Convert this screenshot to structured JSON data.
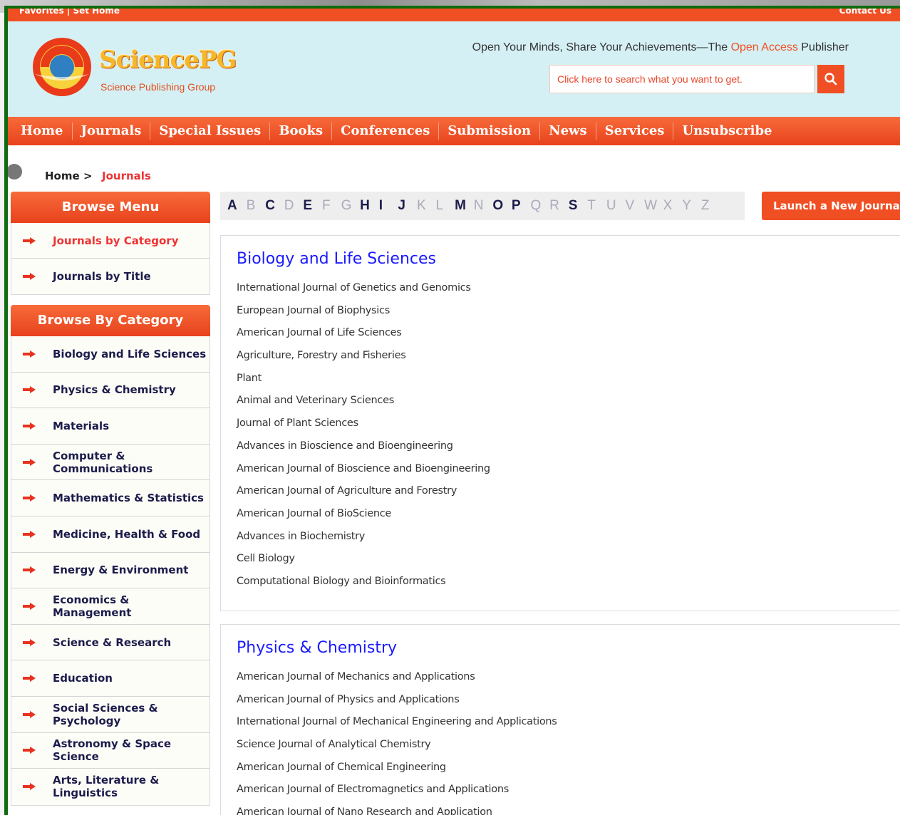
{
  "topbar": {
    "left": "Favorites  |  Set Home",
    "right": "Contact Us"
  },
  "header": {
    "logo_text": "SciencePG",
    "logo_sub": "Science Publishing Group",
    "slogan_pre": "Open Your Minds, Share Your Achievements—The ",
    "slogan_hl": "Open Access",
    "slogan_post": " Publisher",
    "search_placeholder": "Click here to search what you want to get."
  },
  "nav": [
    "Home",
    "Journals",
    "Special Issues",
    "Books",
    "Conferences",
    "Submission",
    "News",
    "Services",
    "Unsubscribe"
  ],
  "breadcrumb": {
    "home": "Home",
    "sep": ">",
    "current": "Journals"
  },
  "browse_menu": {
    "title": "Browse Menu",
    "items": [
      "Journals by Category",
      "Journals by Title"
    ]
  },
  "browse_category": {
    "title": "Browse By Category",
    "items": [
      "Biology and Life Sciences",
      "Physics & Chemistry",
      "Materials",
      "Computer & Communications",
      "Mathematics & Statistics",
      "Medicine, Health & Food",
      "Energy & Environment",
      "Economics & Management",
      "Science & Research",
      "Education",
      "Social Sciences & Psychology",
      "Astronomy & Space Science",
      "Arts, Literature & Linguistics"
    ]
  },
  "letters": [
    {
      "l": "A",
      "on": true
    },
    {
      "l": "B",
      "on": false
    },
    {
      "l": "C",
      "on": true
    },
    {
      "l": "D",
      "on": false
    },
    {
      "l": "E",
      "on": true
    },
    {
      "l": "F",
      "on": false
    },
    {
      "l": "G",
      "on": false
    },
    {
      "l": "H",
      "on": true
    },
    {
      "l": "I",
      "on": true
    },
    {
      "l": "J",
      "on": true
    },
    {
      "l": "K",
      "on": false
    },
    {
      "l": "L",
      "on": false
    },
    {
      "l": "M",
      "on": true
    },
    {
      "l": "N",
      "on": false
    },
    {
      "l": "O",
      "on": true
    },
    {
      "l": "P",
      "on": true
    },
    {
      "l": "Q",
      "on": false
    },
    {
      "l": "R",
      "on": false
    },
    {
      "l": "S",
      "on": true
    },
    {
      "l": "T",
      "on": false
    },
    {
      "l": "U",
      "on": false
    },
    {
      "l": "V",
      "on": false
    },
    {
      "l": "W",
      "on": false
    },
    {
      "l": "X",
      "on": false
    },
    {
      "l": "Y",
      "on": false
    },
    {
      "l": "Z",
      "on": false
    }
  ],
  "launch_label": "Launch a New Journal",
  "sections": [
    {
      "title": "Biology and Life Sciences",
      "journals": [
        "International Journal of Genetics and Genomics",
        "European Journal of Biophysics",
        "American Journal of Life Sciences",
        "Agriculture, Forestry and Fisheries",
        "Plant",
        "Animal and Veterinary Sciences",
        "Journal of Plant Sciences",
        "Advances in Bioscience and Bioengineering",
        "American Journal of Bioscience and Bioengineering",
        "American Journal of Agriculture and Forestry",
        "American Journal of BioScience",
        "Advances in Biochemistry",
        "Cell Biology",
        "Computational Biology and Bioinformatics"
      ]
    },
    {
      "title": "Physics & Chemistry",
      "journals": [
        "American Journal of Mechanics and Applications",
        "American Journal of Physics and Applications",
        "International Journal of Mechanical Engineering and Applications",
        "Science Journal of Analytical Chemistry",
        "American Journal of Chemical Engineering",
        "American Journal of Electromagnetics and Applications",
        "American Journal of Nano Research and Application"
      ]
    }
  ],
  "colors": {
    "accent": "#f04f23",
    "header_bg": "#d5f0f4",
    "link_blue": "#1a1aff",
    "frame_green": "#0e6b0e"
  }
}
